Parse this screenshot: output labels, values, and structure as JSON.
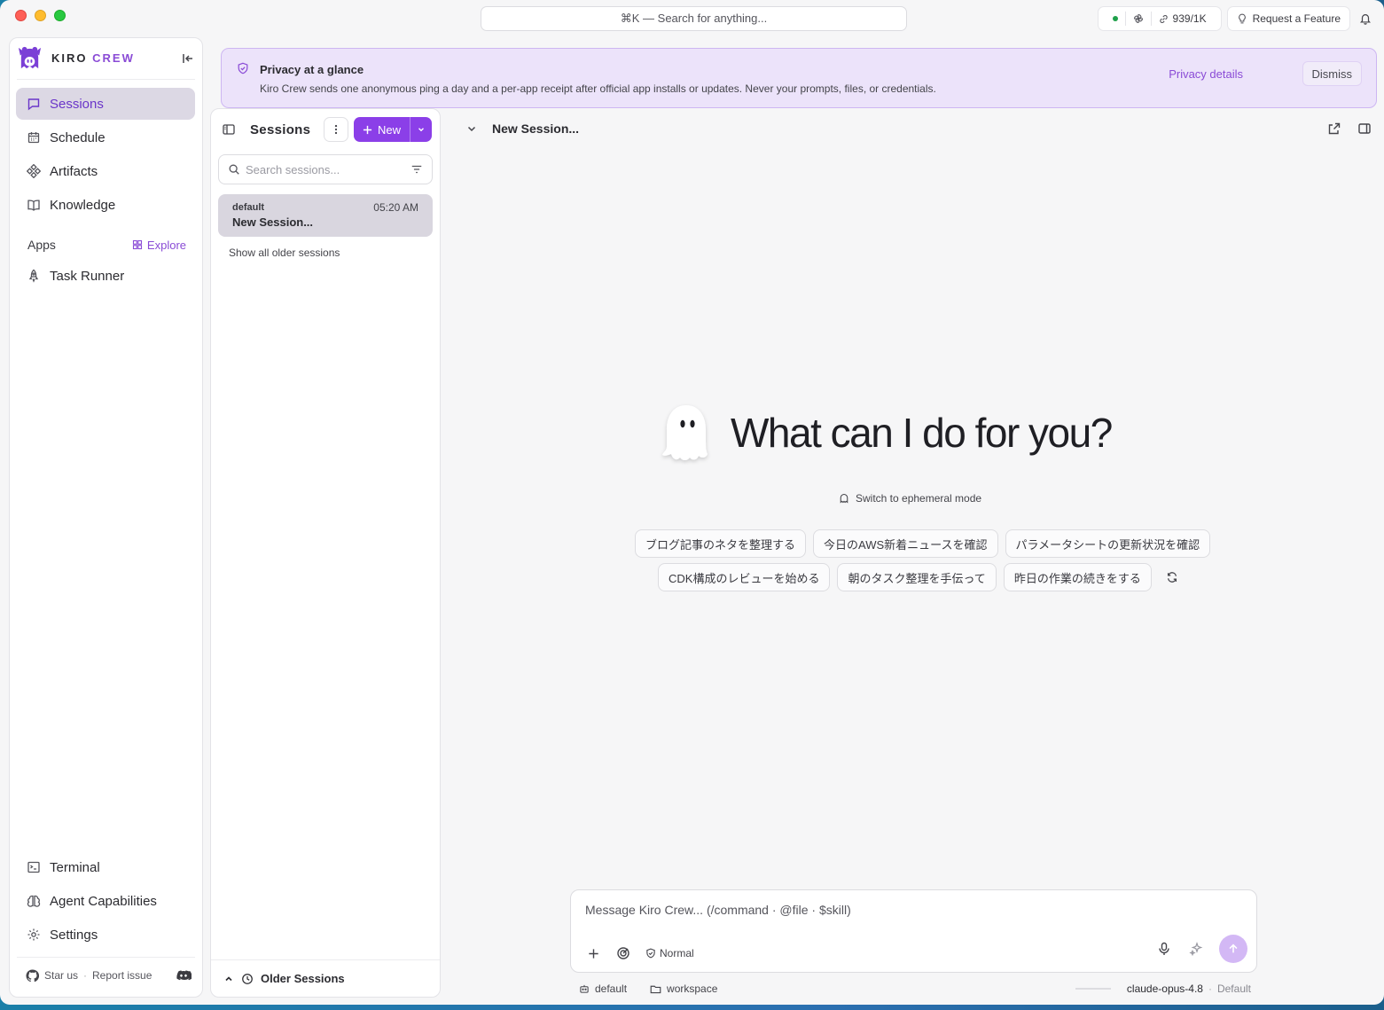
{
  "topbar": {
    "search_label": "⌘K — Search for anything...",
    "usage": "939/1K",
    "request_feature": "Request a Feature"
  },
  "sidebar": {
    "brand_primary": "KIRO",
    "brand_accent": "CREW",
    "nav": [
      {
        "label": "Sessions",
        "icon": "chat-icon",
        "active": true
      },
      {
        "label": "Schedule",
        "icon": "calendar-icon"
      },
      {
        "label": "Artifacts",
        "icon": "artifacts-icon"
      },
      {
        "label": "Knowledge",
        "icon": "book-icon"
      }
    ],
    "apps_title": "Apps",
    "explore": "Explore",
    "apps": [
      {
        "label": "Task Runner",
        "icon": "rocket-icon"
      }
    ],
    "bottom_nav": [
      {
        "label": "Terminal",
        "icon": "terminal-icon"
      },
      {
        "label": "Agent Capabilities",
        "icon": "brain-icon"
      },
      {
        "label": "Settings",
        "icon": "gear-icon"
      }
    ],
    "footer": {
      "star": "Star us",
      "report": "Report issue"
    }
  },
  "privacy": {
    "title": "Privacy at a glance",
    "text": "Kiro Crew sends one anonymous ping a day and a per-app receipt after official app installs or updates. Never your prompts, files, or credentials.",
    "details": "Privacy details",
    "dismiss": "Dismiss"
  },
  "sessions_panel": {
    "title": "Sessions",
    "new_label": "New",
    "search_placeholder": "Search sessions...",
    "sessions": [
      {
        "label": "default",
        "time": "05:20 AM",
        "title": "New Session..."
      }
    ],
    "show_older": "Show all older sessions",
    "older_footer": "Older Sessions"
  },
  "main": {
    "title": "New Session...",
    "hero": "What can I do for you?",
    "ephemeral": "Switch to ephemeral mode",
    "chips_row1": [
      "ブログ記事のネタを整理する",
      "今日のAWS新着ニュースを確認",
      "パラメータシートの更新状況を確認"
    ],
    "chips_row2": [
      "CDK構成のレビューを始める",
      "朝のタスク整理を手伝って",
      "昨日の作業の続きをする"
    ],
    "composer_placeholder": "Message Kiro Crew... (/command · @file · $skill)",
    "mode": "Normal"
  },
  "statusbar": {
    "profile": "default",
    "folder": "workspace",
    "model": "claude-opus-4.8",
    "model_mode": "Default"
  },
  "colors": {
    "accent": "#8b3fe8",
    "banner_bg": "#ece3fa",
    "active_nav_bg": "#dcd8e4"
  }
}
